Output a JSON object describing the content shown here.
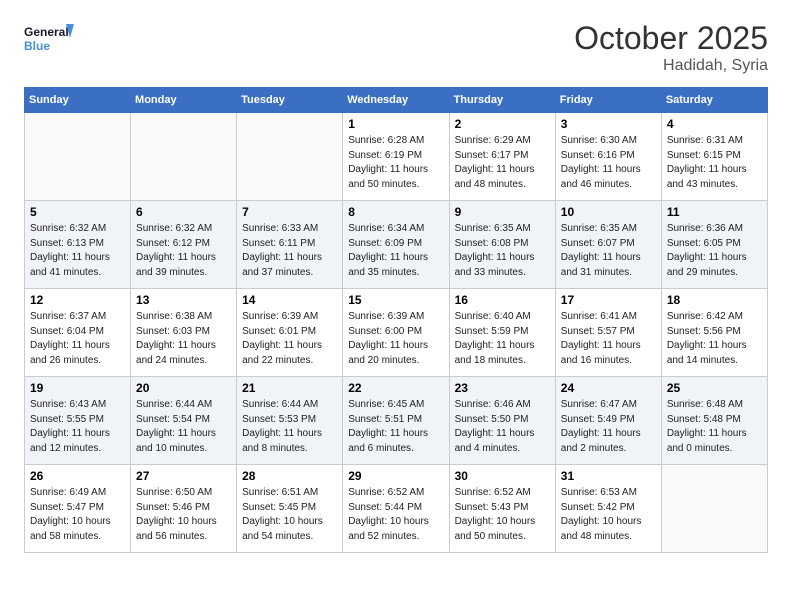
{
  "header": {
    "logo_line1": "General",
    "logo_line2": "Blue",
    "month": "October 2025",
    "location": "Hadidah, Syria"
  },
  "days_of_week": [
    "Sunday",
    "Monday",
    "Tuesday",
    "Wednesday",
    "Thursday",
    "Friday",
    "Saturday"
  ],
  "weeks": [
    [
      {
        "day": "",
        "info": ""
      },
      {
        "day": "",
        "info": ""
      },
      {
        "day": "",
        "info": ""
      },
      {
        "day": "1",
        "info": "Sunrise: 6:28 AM\nSunset: 6:19 PM\nDaylight: 11 hours\nand 50 minutes."
      },
      {
        "day": "2",
        "info": "Sunrise: 6:29 AM\nSunset: 6:17 PM\nDaylight: 11 hours\nand 48 minutes."
      },
      {
        "day": "3",
        "info": "Sunrise: 6:30 AM\nSunset: 6:16 PM\nDaylight: 11 hours\nand 46 minutes."
      },
      {
        "day": "4",
        "info": "Sunrise: 6:31 AM\nSunset: 6:15 PM\nDaylight: 11 hours\nand 43 minutes."
      }
    ],
    [
      {
        "day": "5",
        "info": "Sunrise: 6:32 AM\nSunset: 6:13 PM\nDaylight: 11 hours\nand 41 minutes."
      },
      {
        "day": "6",
        "info": "Sunrise: 6:32 AM\nSunset: 6:12 PM\nDaylight: 11 hours\nand 39 minutes."
      },
      {
        "day": "7",
        "info": "Sunrise: 6:33 AM\nSunset: 6:11 PM\nDaylight: 11 hours\nand 37 minutes."
      },
      {
        "day": "8",
        "info": "Sunrise: 6:34 AM\nSunset: 6:09 PM\nDaylight: 11 hours\nand 35 minutes."
      },
      {
        "day": "9",
        "info": "Sunrise: 6:35 AM\nSunset: 6:08 PM\nDaylight: 11 hours\nand 33 minutes."
      },
      {
        "day": "10",
        "info": "Sunrise: 6:35 AM\nSunset: 6:07 PM\nDaylight: 11 hours\nand 31 minutes."
      },
      {
        "day": "11",
        "info": "Sunrise: 6:36 AM\nSunset: 6:05 PM\nDaylight: 11 hours\nand 29 minutes."
      }
    ],
    [
      {
        "day": "12",
        "info": "Sunrise: 6:37 AM\nSunset: 6:04 PM\nDaylight: 11 hours\nand 26 minutes."
      },
      {
        "day": "13",
        "info": "Sunrise: 6:38 AM\nSunset: 6:03 PM\nDaylight: 11 hours\nand 24 minutes."
      },
      {
        "day": "14",
        "info": "Sunrise: 6:39 AM\nSunset: 6:01 PM\nDaylight: 11 hours\nand 22 minutes."
      },
      {
        "day": "15",
        "info": "Sunrise: 6:39 AM\nSunset: 6:00 PM\nDaylight: 11 hours\nand 20 minutes."
      },
      {
        "day": "16",
        "info": "Sunrise: 6:40 AM\nSunset: 5:59 PM\nDaylight: 11 hours\nand 18 minutes."
      },
      {
        "day": "17",
        "info": "Sunrise: 6:41 AM\nSunset: 5:57 PM\nDaylight: 11 hours\nand 16 minutes."
      },
      {
        "day": "18",
        "info": "Sunrise: 6:42 AM\nSunset: 5:56 PM\nDaylight: 11 hours\nand 14 minutes."
      }
    ],
    [
      {
        "day": "19",
        "info": "Sunrise: 6:43 AM\nSunset: 5:55 PM\nDaylight: 11 hours\nand 12 minutes."
      },
      {
        "day": "20",
        "info": "Sunrise: 6:44 AM\nSunset: 5:54 PM\nDaylight: 11 hours\nand 10 minutes."
      },
      {
        "day": "21",
        "info": "Sunrise: 6:44 AM\nSunset: 5:53 PM\nDaylight: 11 hours\nand 8 minutes."
      },
      {
        "day": "22",
        "info": "Sunrise: 6:45 AM\nSunset: 5:51 PM\nDaylight: 11 hours\nand 6 minutes."
      },
      {
        "day": "23",
        "info": "Sunrise: 6:46 AM\nSunset: 5:50 PM\nDaylight: 11 hours\nand 4 minutes."
      },
      {
        "day": "24",
        "info": "Sunrise: 6:47 AM\nSunset: 5:49 PM\nDaylight: 11 hours\nand 2 minutes."
      },
      {
        "day": "25",
        "info": "Sunrise: 6:48 AM\nSunset: 5:48 PM\nDaylight: 11 hours\nand 0 minutes."
      }
    ],
    [
      {
        "day": "26",
        "info": "Sunrise: 6:49 AM\nSunset: 5:47 PM\nDaylight: 10 hours\nand 58 minutes."
      },
      {
        "day": "27",
        "info": "Sunrise: 6:50 AM\nSunset: 5:46 PM\nDaylight: 10 hours\nand 56 minutes."
      },
      {
        "day": "28",
        "info": "Sunrise: 6:51 AM\nSunset: 5:45 PM\nDaylight: 10 hours\nand 54 minutes."
      },
      {
        "day": "29",
        "info": "Sunrise: 6:52 AM\nSunset: 5:44 PM\nDaylight: 10 hours\nand 52 minutes."
      },
      {
        "day": "30",
        "info": "Sunrise: 6:52 AM\nSunset: 5:43 PM\nDaylight: 10 hours\nand 50 minutes."
      },
      {
        "day": "31",
        "info": "Sunrise: 6:53 AM\nSunset: 5:42 PM\nDaylight: 10 hours\nand 48 minutes."
      },
      {
        "day": "",
        "info": ""
      }
    ]
  ]
}
